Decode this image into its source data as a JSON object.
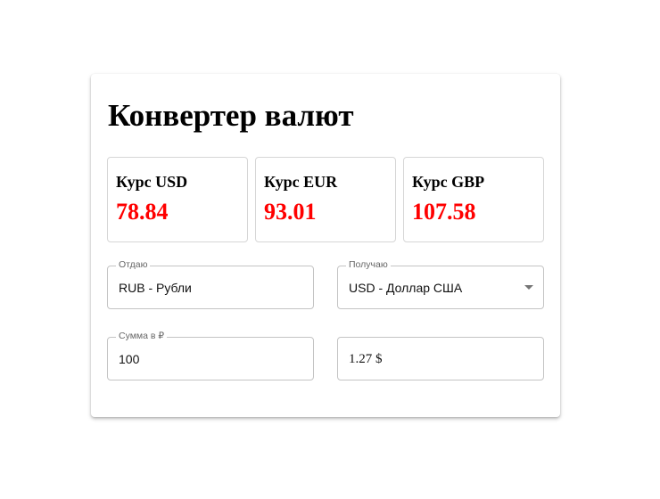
{
  "title": "Конвертер валют",
  "colors": {
    "rate_value": "#ff0000",
    "field_border": "#c4c4c4",
    "legend": "#666666"
  },
  "rates": [
    {
      "label": "Курс USD",
      "value": "78.84"
    },
    {
      "label": "Курс EUR",
      "value": "93.01"
    },
    {
      "label": "Курс GBP",
      "value": "107.58"
    }
  ],
  "give": {
    "label": "Отдаю",
    "value": "RUB - Рубли"
  },
  "receive": {
    "label": "Получаю",
    "value": "USD - Доллар США",
    "icon": "caret-down-icon"
  },
  "amount": {
    "label": "Сумма в ₽",
    "value": "100"
  },
  "result": {
    "value": "1.27 $"
  }
}
